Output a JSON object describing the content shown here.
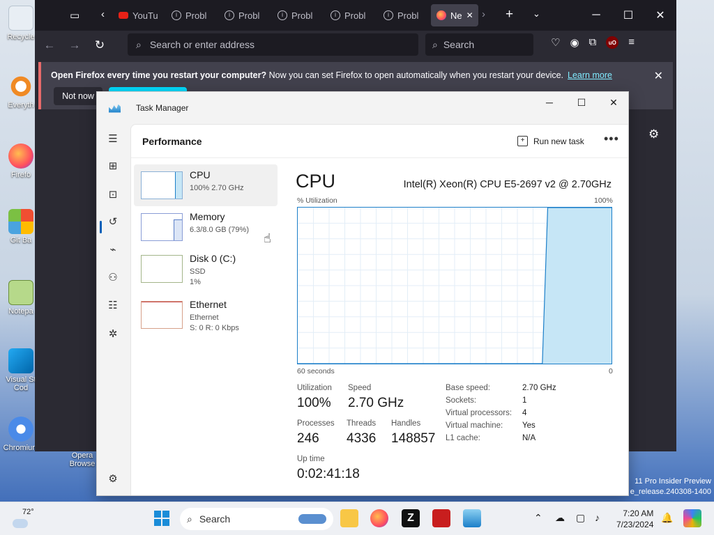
{
  "desktop": {
    "icons": [
      "Recycle",
      "Everyth",
      "Firefo",
      "Git Ba",
      "Notepa",
      "Visual St\nCod",
      "Chromium",
      "Opera\nBrowse"
    ],
    "watermark_line1": "11 Pro Insider Preview",
    "watermark_line2": "e_release.240308-1400"
  },
  "firefox": {
    "tabs": [
      {
        "label": "YouTu",
        "icon": "youtube-icon"
      },
      {
        "label": "Probl",
        "icon": "info-icon"
      },
      {
        "label": "Probl",
        "icon": "info-icon"
      },
      {
        "label": "Probl",
        "icon": "info-icon"
      },
      {
        "label": "Probl",
        "icon": "info-icon"
      },
      {
        "label": "Probl",
        "icon": "info-icon"
      },
      {
        "label": "Ne",
        "icon": "firefox-icon",
        "active": true
      }
    ],
    "url_placeholder": "Search or enter address",
    "search_placeholder": "Search",
    "ublock_label": "uO",
    "notification": {
      "bold_text": "Open Firefox every time you restart your computer?",
      "text": " Now you can set Firefox to open automatically when you restart your device.",
      "link": "Learn more",
      "not_now": "Not now"
    }
  },
  "task_manager": {
    "title": "Task Manager",
    "page_title": "Performance",
    "run_new_task": "Run new task",
    "resources": [
      {
        "name": "CPU",
        "sub1": "100%  2.70 GHz",
        "sub2": ""
      },
      {
        "name": "Memory",
        "sub1": "6.3/8.0 GB (79%)",
        "sub2": ""
      },
      {
        "name": "Disk 0 (C:)",
        "sub1": "SSD",
        "sub2": "1%"
      },
      {
        "name": "Ethernet",
        "sub1": "Ethernet",
        "sub2": "S: 0  R: 0 Kbps"
      }
    ],
    "cpu": {
      "title": "CPU",
      "model": "Intel(R) Xeon(R) CPU E5-2697 v2 @ 2.70GHz",
      "utilization_label": "% Utilization",
      "max_label": "100%",
      "time_label": "60 seconds",
      "min_label": "0",
      "utilization_history": [
        0,
        0,
        0,
        0,
        0,
        0,
        0,
        0,
        0,
        0,
        0,
        0,
        0,
        0,
        0,
        0,
        0,
        0,
        0,
        0,
        0,
        0,
        0,
        0,
        0,
        0,
        0,
        0,
        0,
        0,
        0,
        0,
        0,
        0,
        0,
        0,
        0,
        0,
        0,
        0,
        0,
        0,
        0,
        0,
        0,
        0,
        0,
        100,
        100,
        100,
        100,
        100,
        100,
        100,
        100,
        100,
        100,
        100,
        100,
        100
      ],
      "stats": {
        "utilization": {
          "label": "Utilization",
          "value": "100%"
        },
        "speed": {
          "label": "Speed",
          "value": "2.70 GHz"
        },
        "processes": {
          "label": "Processes",
          "value": "246"
        },
        "threads": {
          "label": "Threads",
          "value": "4336"
        },
        "handles": {
          "label": "Handles",
          "value": "148857"
        },
        "uptime": {
          "label": "Up time",
          "value": "0:02:41:18"
        }
      },
      "details": [
        {
          "label": "Base speed:",
          "value": "2.70 GHz"
        },
        {
          "label": "Sockets:",
          "value": "1"
        },
        {
          "label": "Virtual processors:",
          "value": "4"
        },
        {
          "label": "Virtual machine:",
          "value": "Yes"
        },
        {
          "label": "L1 cache:",
          "value": "N/A"
        }
      ]
    }
  },
  "taskbar": {
    "weather_temp": "72°",
    "search_placeholder": "Search",
    "time": "7:20 AM",
    "date": "7/23/2024"
  },
  "colors": {
    "cpu_fill": "#c6e6f6",
    "cpu_line": "#1c7fc9",
    "grid": "#e3eef7"
  }
}
